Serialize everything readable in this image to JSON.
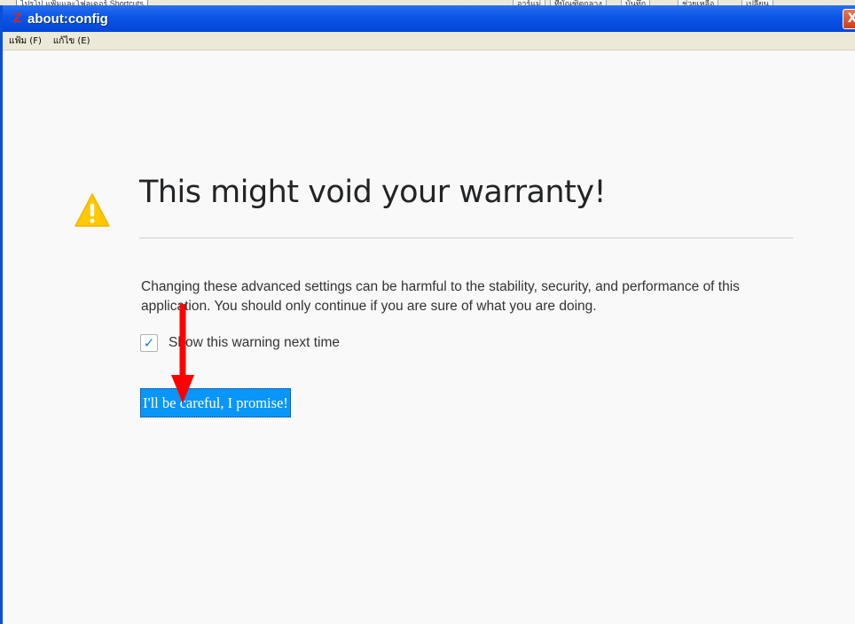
{
  "background_window": {
    "left_text": "ไปรโป แฟ้มและโฟลเดอร์ Shortcuts",
    "tabs": [
      "อาร์แม่",
      "ที่บัณฑิตกลาง",
      "บันทึก",
      "ช่วยเหลือ",
      "เปลี่ยน"
    ]
  },
  "window": {
    "title": "about:config",
    "icon": "firefox-z-icon",
    "close_label": "X"
  },
  "menubar": {
    "items": [
      "แฟ้ม (F)",
      "แก้ไข (E)"
    ]
  },
  "warning": {
    "icon": "warning-triangle-icon",
    "heading": "This might void your warranty!",
    "description": "Changing these advanced settings can be harmful to the stability, security, and performance of this application. You should only continue if you are sure of what you are doing.",
    "checkbox_label": "Show this warning next time",
    "checkbox_checked": true,
    "button_label": "I'll be careful, I promise!"
  },
  "colors": {
    "titlebar": "#0a55e6",
    "button": "#0996f8",
    "warning_icon": "#ffc800",
    "annotation_arrow": "#ff0000"
  }
}
